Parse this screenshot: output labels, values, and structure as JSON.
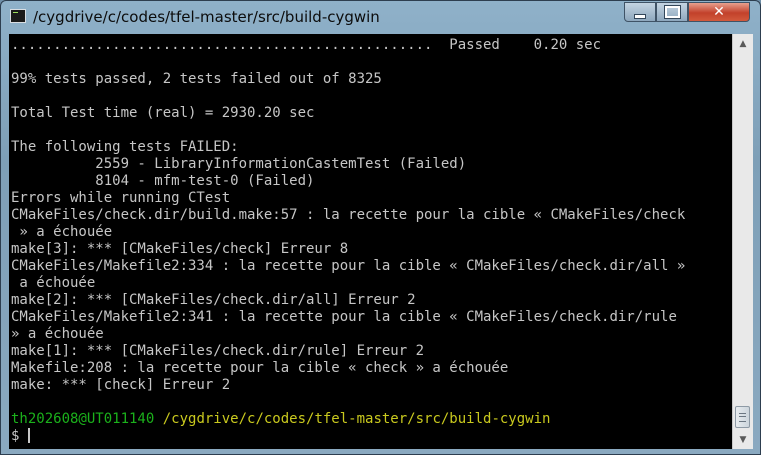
{
  "window": {
    "title": "/cygdrive/c/codes/tfel-master/src/build-cygwin",
    "controls": {
      "minimize": "",
      "maximize": "",
      "close": "✕"
    },
    "icons": {
      "app": "terminal-icon",
      "minimize": "minimize-icon",
      "maximize": "maximize-icon",
      "close": "close-icon"
    }
  },
  "terminal": {
    "colors": {
      "background": "#000000",
      "text": "#c6c6c6",
      "prompt_user": "#1bb11b",
      "prompt_path": "#c9c91e"
    },
    "lines": [
      "..................................................  Passed    0.20 sec",
      "",
      "99% tests passed, 2 tests failed out of 8325",
      "",
      "Total Test time (real) = 2930.20 sec",
      "",
      "The following tests FAILED:",
      "\t  2559 - LibraryInformationCastemTest (Failed)",
      "\t  8104 - mfm-test-0 (Failed)",
      "Errors while running CTest",
      "CMakeFiles/check.dir/build.make:57 : la recette pour la cible « CMakeFiles/check",
      " » a échouée",
      "make[3]: *** [CMakeFiles/check] Erreur 8",
      "CMakeFiles/Makefile2:334 : la recette pour la cible « CMakeFiles/check.dir/all »",
      " a échouée",
      "make[2]: *** [CMakeFiles/check.dir/all] Erreur 2",
      "CMakeFiles/Makefile2:341 : la recette pour la cible « CMakeFiles/check.dir/rule",
      "» a échouée",
      "make[1]: *** [CMakeFiles/check.dir/rule] Erreur 2",
      "Makefile:208 : la recette pour la cible « check » a échouée",
      "make: *** [check] Erreur 2",
      ""
    ],
    "prompt": {
      "user_host": "th202608@UT011140",
      "path": "/cygdrive/c/codes/tfel-master/src/build-cygwin",
      "symbol": "$ "
    }
  },
  "scrollbar": {
    "up_arrow": "▲",
    "down_arrow": "▼"
  }
}
